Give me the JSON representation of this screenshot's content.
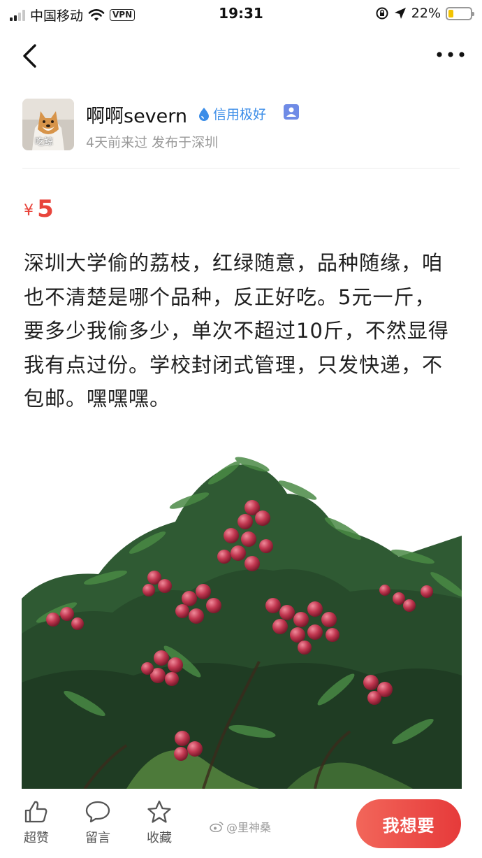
{
  "status_bar": {
    "carrier": "中国移动",
    "vpn": "VPN",
    "time": "19:31",
    "battery_percent": "22%",
    "battery_level": 0.22
  },
  "nav": {
    "back_icon": "chevron-left-icon",
    "more_icon": "ellipsis-icon"
  },
  "seller": {
    "avatar_caption": "吃鲸",
    "name": "啊啊severn",
    "credit": "信用极好",
    "meta": "4天前来过  发布于深圳"
  },
  "listing": {
    "price_currency": "¥",
    "price_value": "5",
    "description": "深圳大学偷的荔枝，红绿随意，品种随缘，咱也不清楚是哪个品种，反正好吃。5元一斤，要多少我偷多少，单次不超过10斤，不然显得我有点过份。学校封闭式管理，只发快递，不包邮。嘿嘿嘿。"
  },
  "bottom_bar": {
    "like_label": "超赞",
    "comment_label": "留言",
    "favorite_label": "收藏",
    "want_label": "我想要",
    "watermark": "@里神桑"
  },
  "colors": {
    "price": "#e8453c",
    "credit": "#3b8de8",
    "want_button": "#e84a44"
  }
}
